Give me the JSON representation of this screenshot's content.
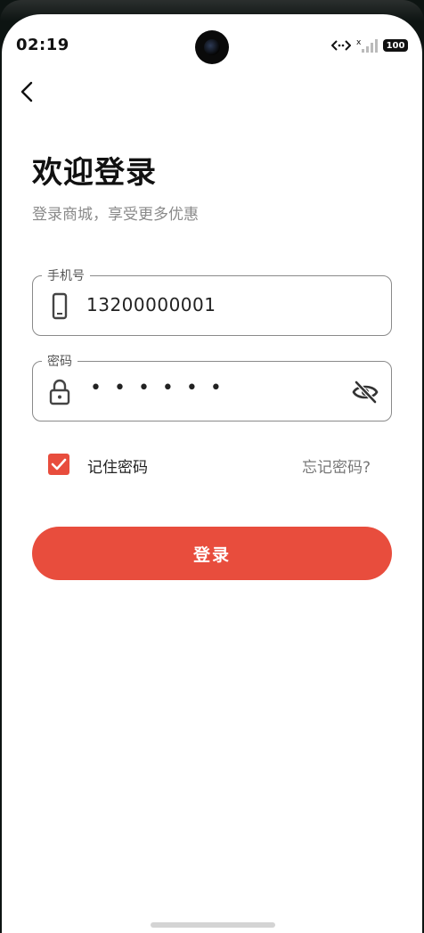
{
  "status_bar": {
    "time": "02:19",
    "signal_label": "x",
    "battery": "100"
  },
  "header": {
    "back_icon": "chevron-left-icon"
  },
  "main": {
    "title": "欢迎登录",
    "subtitle": "登录商城，享受更多优惠"
  },
  "phone_field": {
    "label": "手机号",
    "value": "13200000001",
    "icon": "smartphone-icon"
  },
  "password_field": {
    "label": "密码",
    "value": "••••••",
    "icon": "lock-icon",
    "toggle_icon": "eye-off-icon"
  },
  "options": {
    "remember_label": "记住密码",
    "remember_checked": true,
    "forgot_label": "忘记密码?"
  },
  "actions": {
    "login_label": "登录"
  },
  "colors": {
    "accent": "#e84d3d",
    "text": "#111111",
    "muted": "#8a8a8a"
  }
}
